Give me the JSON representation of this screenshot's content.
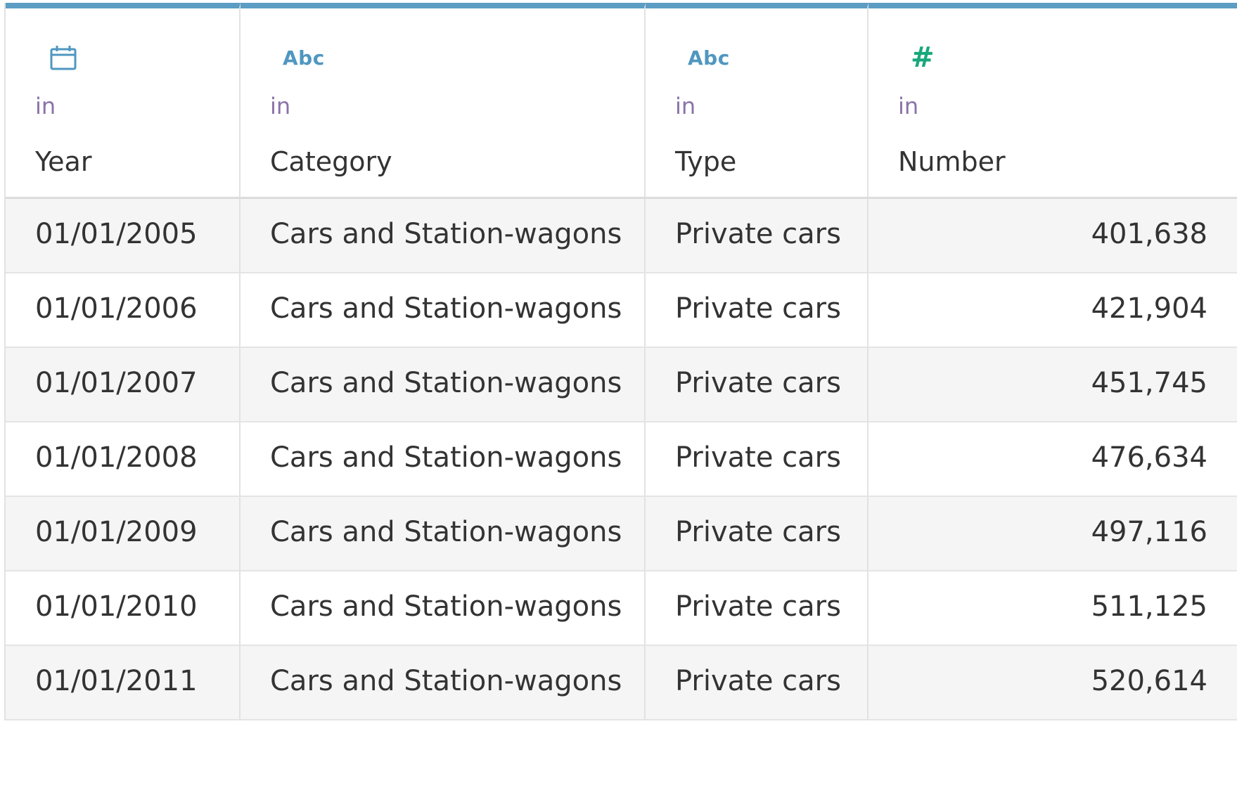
{
  "columns": [
    {
      "icon": "calendar-icon",
      "source": "in",
      "name": "Year"
    },
    {
      "icon": "abc-icon",
      "icon_text": "Abc",
      "source": "in",
      "name": "Category"
    },
    {
      "icon": "abc-icon",
      "icon_text": "Abc",
      "source": "in",
      "name": "Type"
    },
    {
      "icon": "hash-icon",
      "icon_text": "#",
      "source": "in",
      "name": "Number"
    }
  ],
  "rows": [
    {
      "year": "01/01/2005",
      "category": "Cars and Station-wagons",
      "type": "Private cars",
      "number": "401,638"
    },
    {
      "year": "01/01/2006",
      "category": "Cars and Station-wagons",
      "type": "Private cars",
      "number": "421,904"
    },
    {
      "year": "01/01/2007",
      "category": "Cars and Station-wagons",
      "type": "Private cars",
      "number": "451,745"
    },
    {
      "year": "01/01/2008",
      "category": "Cars and Station-wagons",
      "type": "Private cars",
      "number": "476,634"
    },
    {
      "year": "01/01/2009",
      "category": "Cars and Station-wagons",
      "type": "Private cars",
      "number": "497,116"
    },
    {
      "year": "01/01/2010",
      "category": "Cars and Station-wagons",
      "type": "Private cars",
      "number": "511,125"
    },
    {
      "year": "01/01/2011",
      "category": "Cars and Station-wagons",
      "type": "Private cars",
      "number": "520,614"
    }
  ],
  "colors": {
    "header_accent": "#5b9dc4",
    "string_icon": "#4f97c0",
    "number_icon": "#18a87b",
    "source_text": "#8a72a8",
    "alt_row": "#f5f5f5"
  }
}
